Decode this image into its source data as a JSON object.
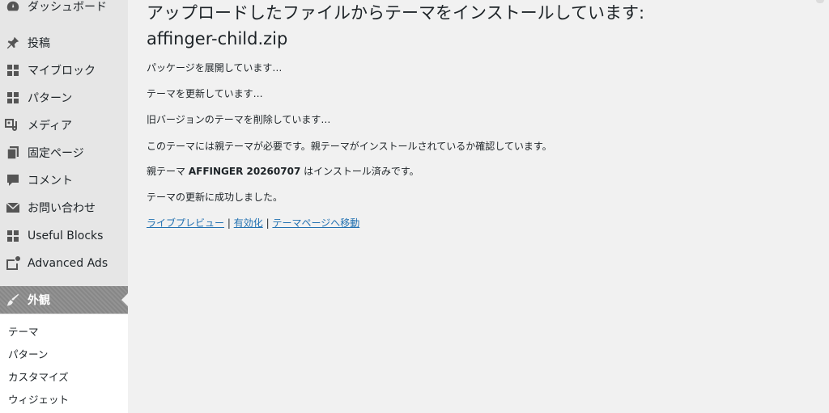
{
  "sidebar": {
    "items": [
      {
        "label": "ダッシュボード",
        "icon": "dashboard-icon"
      },
      {
        "label": "投稿",
        "icon": "pin-icon"
      },
      {
        "label": "マイブロック",
        "icon": "grid-icon"
      },
      {
        "label": "パターン",
        "icon": "grid-icon"
      },
      {
        "label": "メディア",
        "icon": "media-icon"
      },
      {
        "label": "固定ページ",
        "icon": "pages-icon"
      },
      {
        "label": "コメント",
        "icon": "comment-icon"
      },
      {
        "label": "お問い合わせ",
        "icon": "mail-icon"
      },
      {
        "label": "Useful Blocks",
        "icon": "grid-icon"
      },
      {
        "label": "Advanced Ads",
        "icon": "ads-icon"
      },
      {
        "label": "外観",
        "icon": "brush-icon"
      }
    ],
    "submenu": [
      "テーマ",
      "パターン",
      "カスタマイズ",
      "ウィジェット"
    ]
  },
  "main": {
    "title_line1": "アップロードしたファイルからテーマをインストールしています:",
    "title_line2": "affinger-child.zip",
    "messages": [
      "パッケージを展開しています…",
      "テーマを更新しています…",
      "旧バージョンのテーマを削除しています…",
      "このテーマには親テーマが必要です。親テーマがインストールされているか確認しています。"
    ],
    "parent_prefix": "親テーマ",
    "parent_name": "AFFINGER 20260707",
    "parent_suffix": "はインストール済みです。",
    "success": "テーマの更新に成功しました。",
    "links": {
      "live_preview": "ライブプレビュー",
      "activate": "有効化",
      "theme_page": "テーマページへ移動",
      "separator": "|"
    }
  },
  "colors": {
    "accent_link": "#2271b1",
    "sidebar_bg": "#e6e6e6",
    "active_bg": "#8c8c8c",
    "badge": "#d63638"
  }
}
